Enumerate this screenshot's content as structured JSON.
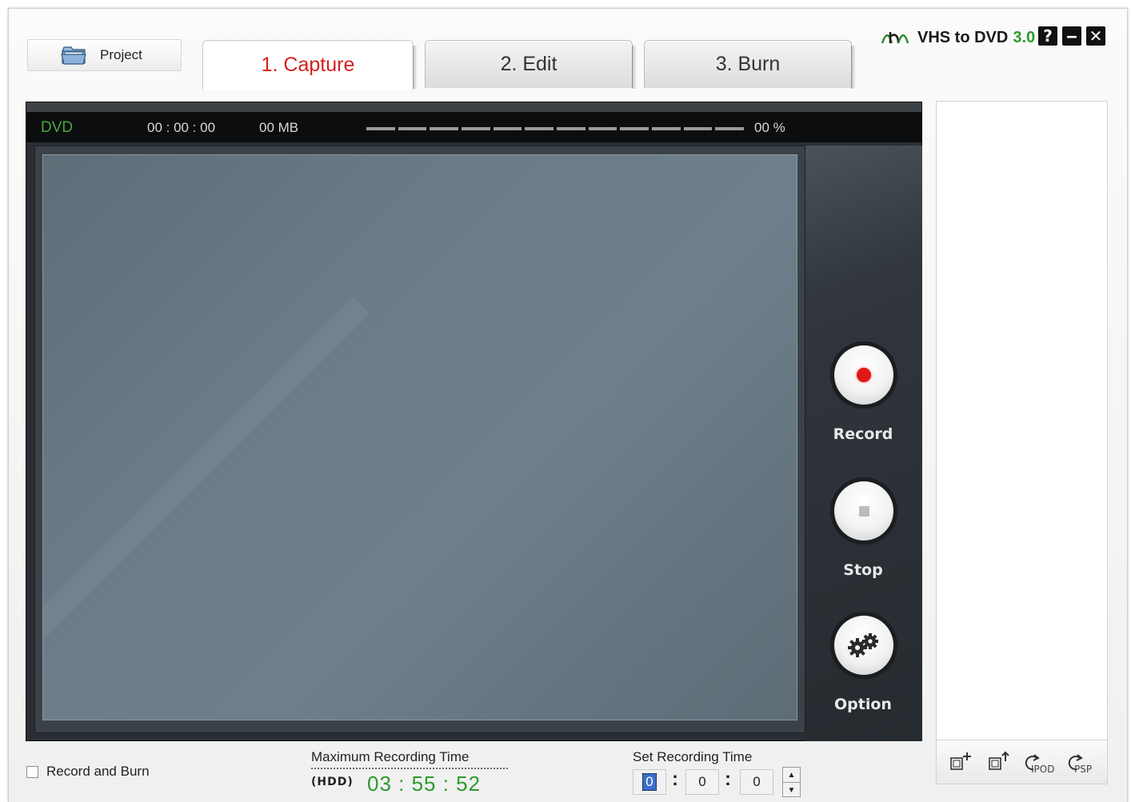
{
  "app": {
    "name": "VHS to DVD",
    "version": "3.0"
  },
  "window_buttons": {
    "help": "?",
    "minimize": "‒",
    "close": "✕"
  },
  "project_button": {
    "label": "Project"
  },
  "tabs": [
    {
      "label": "1. Capture",
      "active": true
    },
    {
      "label": "2. Edit",
      "active": false
    },
    {
      "label": "3. Burn",
      "active": false
    }
  ],
  "monitor": {
    "format": "DVD",
    "time": "00 : 00 : 00",
    "size": "00 MB",
    "percent": "00 %",
    "progress": 0
  },
  "controls": {
    "record": "Record",
    "stop": "Stop",
    "option": "Option"
  },
  "right_toolbar": {
    "ipod": "IPOD",
    "psp": "PSP"
  },
  "bottom": {
    "record_and_burn": "Record and Burn",
    "max_recording_label": "Maximum Recording Time",
    "hdd_label": "(HDD)",
    "max_recording_time": "03 : 55 : 52",
    "set_recording_label": "Set Recording Time",
    "set_hours": "0",
    "set_minutes": "0",
    "set_seconds": "0"
  },
  "colors": {
    "active_tab_text": "#d42020",
    "dvd_text": "#46a83a",
    "max_time_text": "#2d9a2d",
    "record_dot": "#e01818"
  }
}
